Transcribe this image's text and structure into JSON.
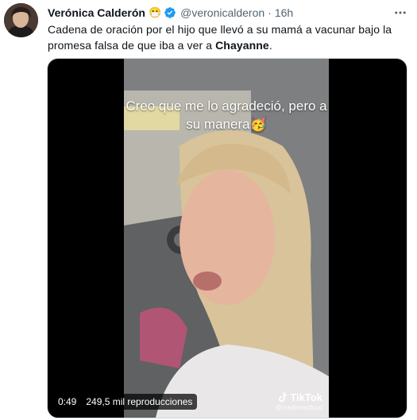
{
  "tweet": {
    "author_name": "Verónica Calderón",
    "author_emoji": "😷",
    "handle": "@veronicalderon",
    "separator": "·",
    "time": "16h",
    "more_icon": "more-icon",
    "verified_icon": "verified-badge-icon",
    "text_before": "Cadena de oración por el hijo que llevó a su mamá a vacunar bajo la promesa falsa de que iba a ver a ",
    "text_bold": "Chayanne",
    "text_after": "."
  },
  "video": {
    "caption": "Creo que me lo agradeció, pero a su manera🥳",
    "watermark_brand": "TikTok",
    "watermark_handle": "@medinnaoficial",
    "duration": "0:49",
    "views": "249,5 mil reproducciones"
  },
  "colors": {
    "text_primary": "#0f1419",
    "text_secondary": "#536471",
    "verified_blue": "#1d9bf0",
    "media_bg": "#000000"
  }
}
